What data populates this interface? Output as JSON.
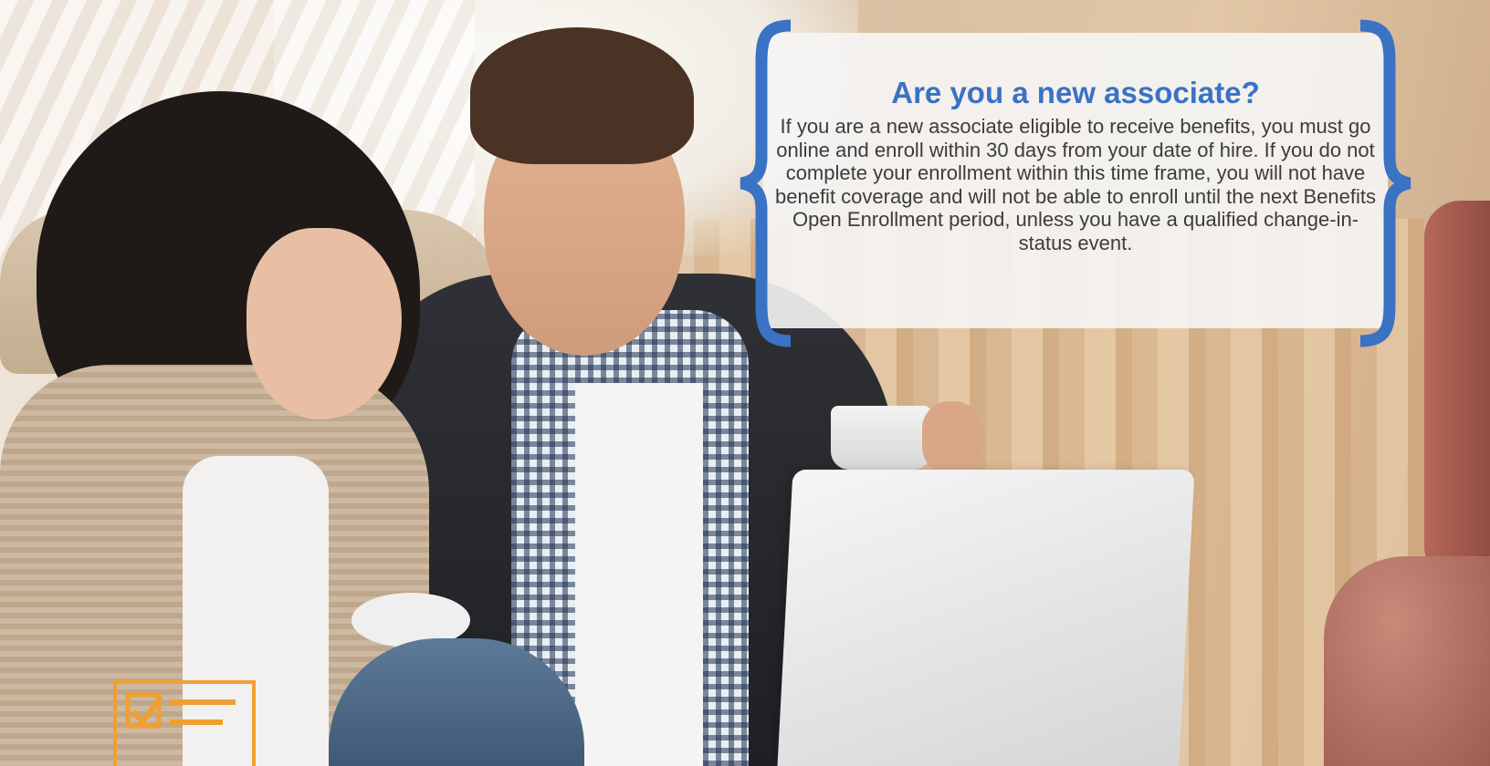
{
  "callout": {
    "title": "Are you a new associate?",
    "body": "If you are a new associate eligible to receive benefits, you must go online and enroll within 30 days from your date of hire. If you do not complete your enrollment within this time frame, you will not have benefit coverage and will not be able to enroll until the next Benefits Open Enrollment period, unless you have a qualified change-in-status event.",
    "accent_color": "#3a72c4"
  },
  "icons": {
    "checklist": "checklist-icon",
    "checklist_color": "#f0a030"
  },
  "background": {
    "image": "background-photo"
  }
}
